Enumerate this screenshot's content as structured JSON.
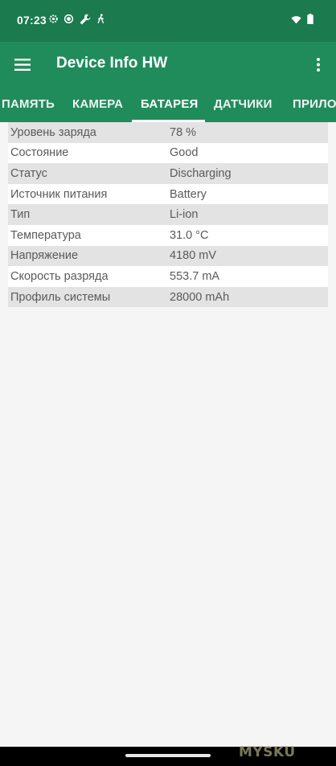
{
  "status_bar": {
    "time": "07:23",
    "left_icons": [
      "gear-icon",
      "record-icon",
      "wrench-icon",
      "walk-icon"
    ],
    "right_icons": [
      "wifi-icon",
      "battery-icon"
    ]
  },
  "app_bar": {
    "title": "Device Info HW",
    "menu_icon": "hamburger-menu-icon",
    "overflow_icon": "more-vertical-icon"
  },
  "tabs": [
    {
      "label": "ПАМЯТЬ",
      "active": false
    },
    {
      "label": "КАМЕРА",
      "active": false
    },
    {
      "label": "БАТАРЕЯ",
      "active": true
    },
    {
      "label": "ДАТЧИКИ",
      "active": false
    },
    {
      "label": "ПРИЛО",
      "active": false
    }
  ],
  "battery_info": [
    {
      "label": "Уровень заряда",
      "value": "78 %"
    },
    {
      "label": "Состояние",
      "value": "Good"
    },
    {
      "label": "Статус",
      "value": "Discharging"
    },
    {
      "label": "Источник питания",
      "value": "Battery"
    },
    {
      "label": "Тип",
      "value": "Li-ion"
    },
    {
      "label": "Температура",
      "value": "31.0 °C"
    },
    {
      "label": "Напряжение",
      "value": "4180 mV"
    },
    {
      "label": "Скорость разряда",
      "value": "553.7 mA"
    },
    {
      "label": "Профиль системы",
      "value": "28000 mAh"
    }
  ],
  "watermark": "MYSKU",
  "colors": {
    "status_bar": "#1b7a4e",
    "app_bar": "#218c5b",
    "row_alt": "#e3e3e3",
    "row": "#ffffff",
    "text": "#5a5a5a",
    "background": "#f5f5f5"
  }
}
